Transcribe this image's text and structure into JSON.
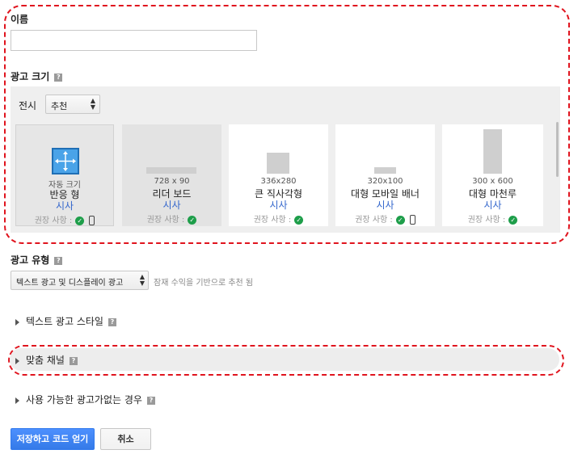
{
  "name_section": {
    "label": "이름",
    "value": ""
  },
  "ad_size": {
    "label": "광고 크기",
    "help_icon": "?",
    "display_label": "전시",
    "display_select": "추천",
    "cards": [
      {
        "dim": "자동 크기",
        "name": "반응 형",
        "preview": "시사",
        "rec": "권장 사항 :"
      },
      {
        "dim": "728 x 90",
        "name": "리더 보드",
        "preview": "시사",
        "rec": "권장 사항 :"
      },
      {
        "dim": "336x280",
        "name": "큰 직사각형",
        "preview": "시사",
        "rec": "권장 사항 :"
      },
      {
        "dim": "320x100",
        "name": "대형 모바일 배너",
        "preview": "시사",
        "rec": "권장 사항 :"
      },
      {
        "dim": "300 x 600",
        "name": "대형 마천루",
        "preview": "시사",
        "rec": "권장 사항 :"
      }
    ]
  },
  "ad_type": {
    "label": "광고 유형",
    "select_value": "텍스트 광고 및 디스플레이 광고",
    "hint": "잠재 수익을 기반으로 추천 됨"
  },
  "sections": {
    "text_style": "텍스트 광고 스타일",
    "custom_channel": "맞춤 채널",
    "fallback": "사용 가능한 광고가없는 경우"
  },
  "buttons": {
    "save": "저장하고 코드 얻기",
    "cancel": "취소"
  },
  "colors": {
    "highlight": "#e0141e",
    "primary": "#4d90fe",
    "check": "#1e9e4a",
    "link": "#3366cc"
  }
}
